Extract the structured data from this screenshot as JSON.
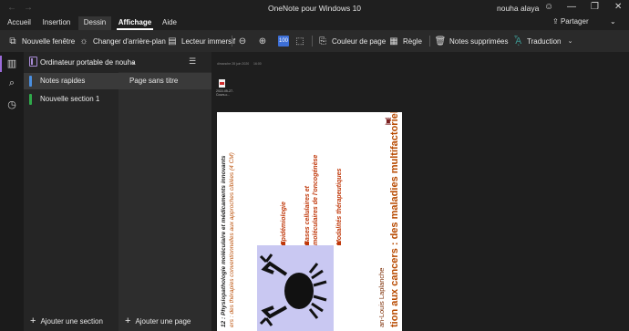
{
  "titlebar": {
    "app_title": "OneNote pour Windows 10",
    "user_name": "nouha alaya",
    "back_icon": "back-arrow-icon",
    "forward_icon": "forward-arrow-icon"
  },
  "ribbon": {
    "tabs": [
      {
        "label": "Accueil"
      },
      {
        "label": "Insertion"
      },
      {
        "label": "Dessin"
      },
      {
        "label": "Affichage"
      },
      {
        "label": "Aide"
      }
    ],
    "active_tab": "Dessin",
    "selected_tab": "Affichage",
    "share_label": "Partager",
    "more_label": "⌄"
  },
  "toolbar": {
    "new_window": "Nouvelle fenêtre",
    "background": "Changer d'arrière-plan",
    "immersive_reader": "Lecteur immersif",
    "page_color": "Couleur de page",
    "ruler": "Règle",
    "deleted_notes": "Notes supprimées",
    "translation": "Traduction"
  },
  "notebook": {
    "name": "Ordinateur portable de nouha",
    "sections": [
      {
        "label": "Notes rapides",
        "color": "#4a8fe0"
      },
      {
        "label": "Nouvelle section 1",
        "color": "#2fa94a"
      }
    ],
    "pages": [
      {
        "label": "Page sans titre"
      }
    ],
    "add_section": "Ajouter une section",
    "add_page": "Ajouter une page"
  },
  "page": {
    "date": "dimanche 28 juin 2020",
    "time": "16:00",
    "attachment_name": "2022-05-27-Cours-c..."
  },
  "slide": {
    "title": "tion aux cancers : des maladies multifactorielles",
    "author": "an-Louis Laplanche",
    "bullets": [
      "Epidémiologie",
      "Bases cellulaires et",
      "moléculaires de l'oncogénèse",
      "Modalités thérapeutiques"
    ],
    "course_title": "12 : Physiopathologie moléculaire et médicaments innovants",
    "course_subtitle": "ers : des thérapies conventionnelles aux approches ciblées (4 CM)"
  },
  "colors": {
    "accent_purple": "#9b6bd9",
    "slide_orange": "#b84a00"
  }
}
